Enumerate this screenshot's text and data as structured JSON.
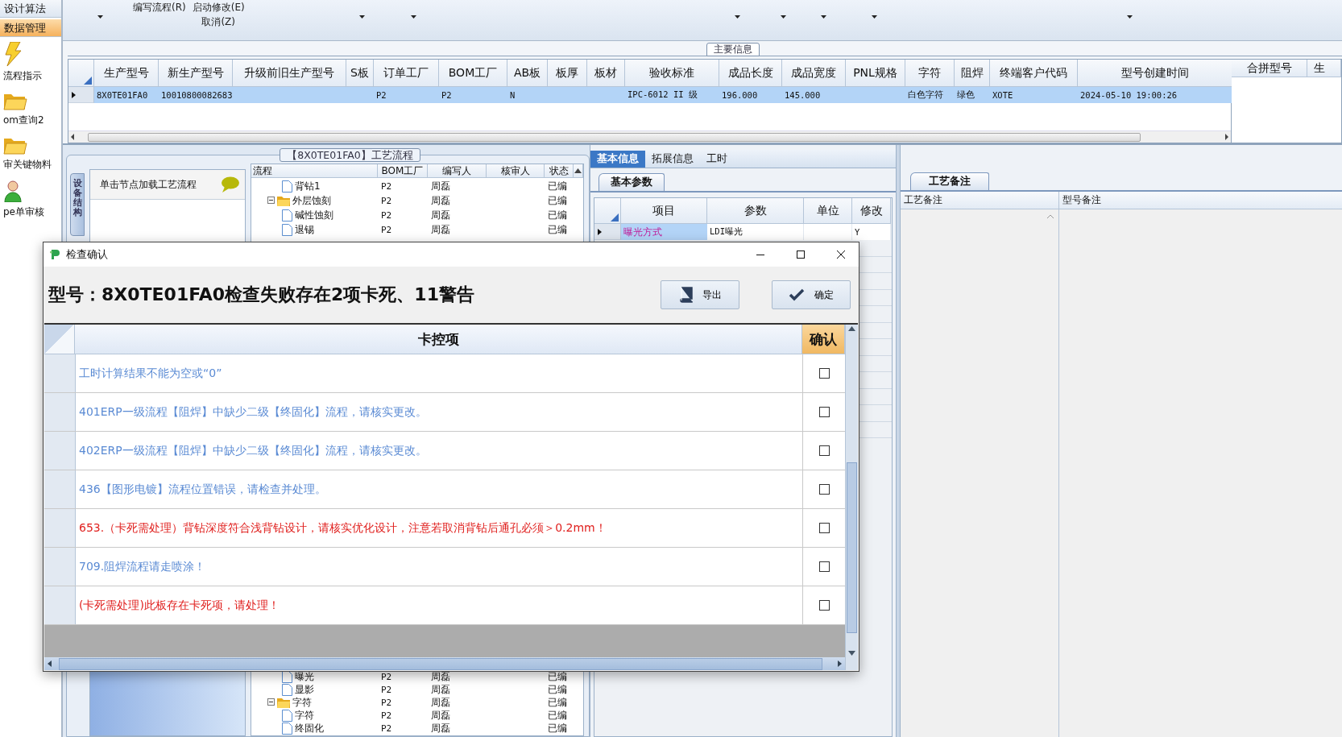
{
  "toolbar": {
    "buttons": [
      {
        "label": "编写流程(R)"
      },
      {
        "label": "启动修改(E)"
      },
      {
        "label": "取消(Z)"
      }
    ]
  },
  "sidebar": {
    "tabs": [
      {
        "label": "设计算法",
        "selected": false
      },
      {
        "label": "数据管理",
        "selected": true
      }
    ],
    "items": [
      {
        "label": "流程指示"
      },
      {
        "label": "om查询2"
      },
      {
        "label": "审关键物料"
      },
      {
        "label": "pe单审核"
      }
    ]
  },
  "main_info": {
    "title": "主要信息",
    "columns": [
      "生产型号",
      "新生产型号",
      "升级前旧生产型号",
      "S板",
      "订单工厂",
      "BOM工厂",
      "AB板",
      "板厚",
      "板材",
      "验收标准",
      "成品长度",
      "成品宽度",
      "PNL规格",
      "字符",
      "阻焊",
      "终端客户代码",
      "型号创建时间"
    ],
    "rows": [
      {
        "selected": true,
        "cells": [
          "8X0TE01FA0",
          "10010800082683",
          null,
          null,
          "P2",
          "P2",
          "N",
          null,
          null,
          "IPC-6012 II 级",
          "196.000",
          "145.000",
          null,
          "白色字符",
          "绿色",
          "XOTE",
          "2024-05-10 19:00:26"
        ]
      }
    ],
    "side_columns": [
      "合拼型号",
      "生"
    ]
  },
  "process": {
    "title": "【8X0TE01FA0】工艺流程",
    "side_tab": "设备结构",
    "node_hint": "单击节点加载工艺流程",
    "tree": {
      "columns": [
        "流程",
        "BOM工厂",
        "编写人",
        "核审人",
        "状态"
      ],
      "top_rows": [
        {
          "name": "背钻1",
          "kind": "file",
          "bom": "P2",
          "writer": "周磊",
          "status": "已编"
        },
        {
          "name": "外层蚀刻",
          "kind": "folder",
          "expanded": true,
          "bom": "P2",
          "writer": "周磊",
          "status": "已编",
          "children": [
            {
              "name": "碱性蚀刻",
              "kind": "file",
              "bom": "P2",
              "writer": "周磊",
              "status": "已编"
            },
            {
              "name": "退锡",
              "kind": "file",
              "bom": "P2",
              "writer": "周磊",
              "status": "已编"
            }
          ]
        }
      ],
      "bottom_rows": [
        {
          "name": "曝光",
          "kind": "file",
          "bom": "P2",
          "writer": "周磊",
          "status": "已编"
        },
        {
          "name": "显影",
          "kind": "file",
          "bom": "P2",
          "writer": "周磊",
          "status": "已编"
        },
        {
          "name": "字符",
          "kind": "folder",
          "expanded": true,
          "bom": "P2",
          "writer": "周磊",
          "status": "已编",
          "children": [
            {
              "name": "字符",
              "kind": "file",
              "bom": "P2",
              "writer": "周磊",
              "status": "已编"
            },
            {
              "name": "终固化",
              "kind": "file",
              "bom": "P2",
              "writer": "周磊",
              "status": "已编"
            }
          ]
        }
      ]
    }
  },
  "info_panel": {
    "tabs": [
      {
        "label": "基本信息",
        "selected": true
      },
      {
        "label": "拓展信息",
        "selected": false
      },
      {
        "label": "工时",
        "selected": false
      }
    ],
    "sub_tab": "基本参数",
    "columns": [
      "项目",
      "参数",
      "单位",
      "修改"
    ],
    "rows": [
      {
        "selected": true,
        "cells": [
          "曝光方式",
          "LDI曝光",
          null,
          "Y"
        ]
      }
    ]
  },
  "notes_panel": {
    "tab": "工艺备注",
    "columns": [
      "工艺备注",
      "型号备注"
    ]
  },
  "dialog": {
    "title": "检查确认",
    "heading": "型号：8X0TE01FA0检查失败存在2项卡死、11警告",
    "buttons": [
      {
        "label": "导出"
      },
      {
        "label": "确定"
      }
    ],
    "columns": [
      "卡控项",
      "确认"
    ],
    "rows": [
      {
        "text": "工时计算结果不能为空或“0”",
        "color": "#5b8bd4",
        "checked": false
      },
      {
        "text": "401ERP一级流程【阻焊】中缺少二级【终固化】流程，请核实更改。",
        "color": "#5b8bd4",
        "checked": false
      },
      {
        "text": "402ERP一级流程【阻焊】中缺少二级【终固化】流程，请核实更改。",
        "color": "#5b8bd4",
        "checked": false
      },
      {
        "text": "436【图形电镀】流程位置错误，请检查并处理。",
        "color": "#5b8bd4",
        "checked": false
      },
      {
        "text": "653.（卡死需处理）背钻深度符合浅背钻设计，请核实优化设计，注意若取消背钻后通孔必须＞0.2mm！",
        "color": "#e0201e",
        "checked": false
      },
      {
        "text": "709.阻焊流程请走喷涂！",
        "color": "#5b8bd4",
        "checked": false
      },
      {
        "text": "(卡死需处理)此板存在卡死项，请处理！",
        "color": "#e0201e",
        "checked": false
      }
    ]
  }
}
